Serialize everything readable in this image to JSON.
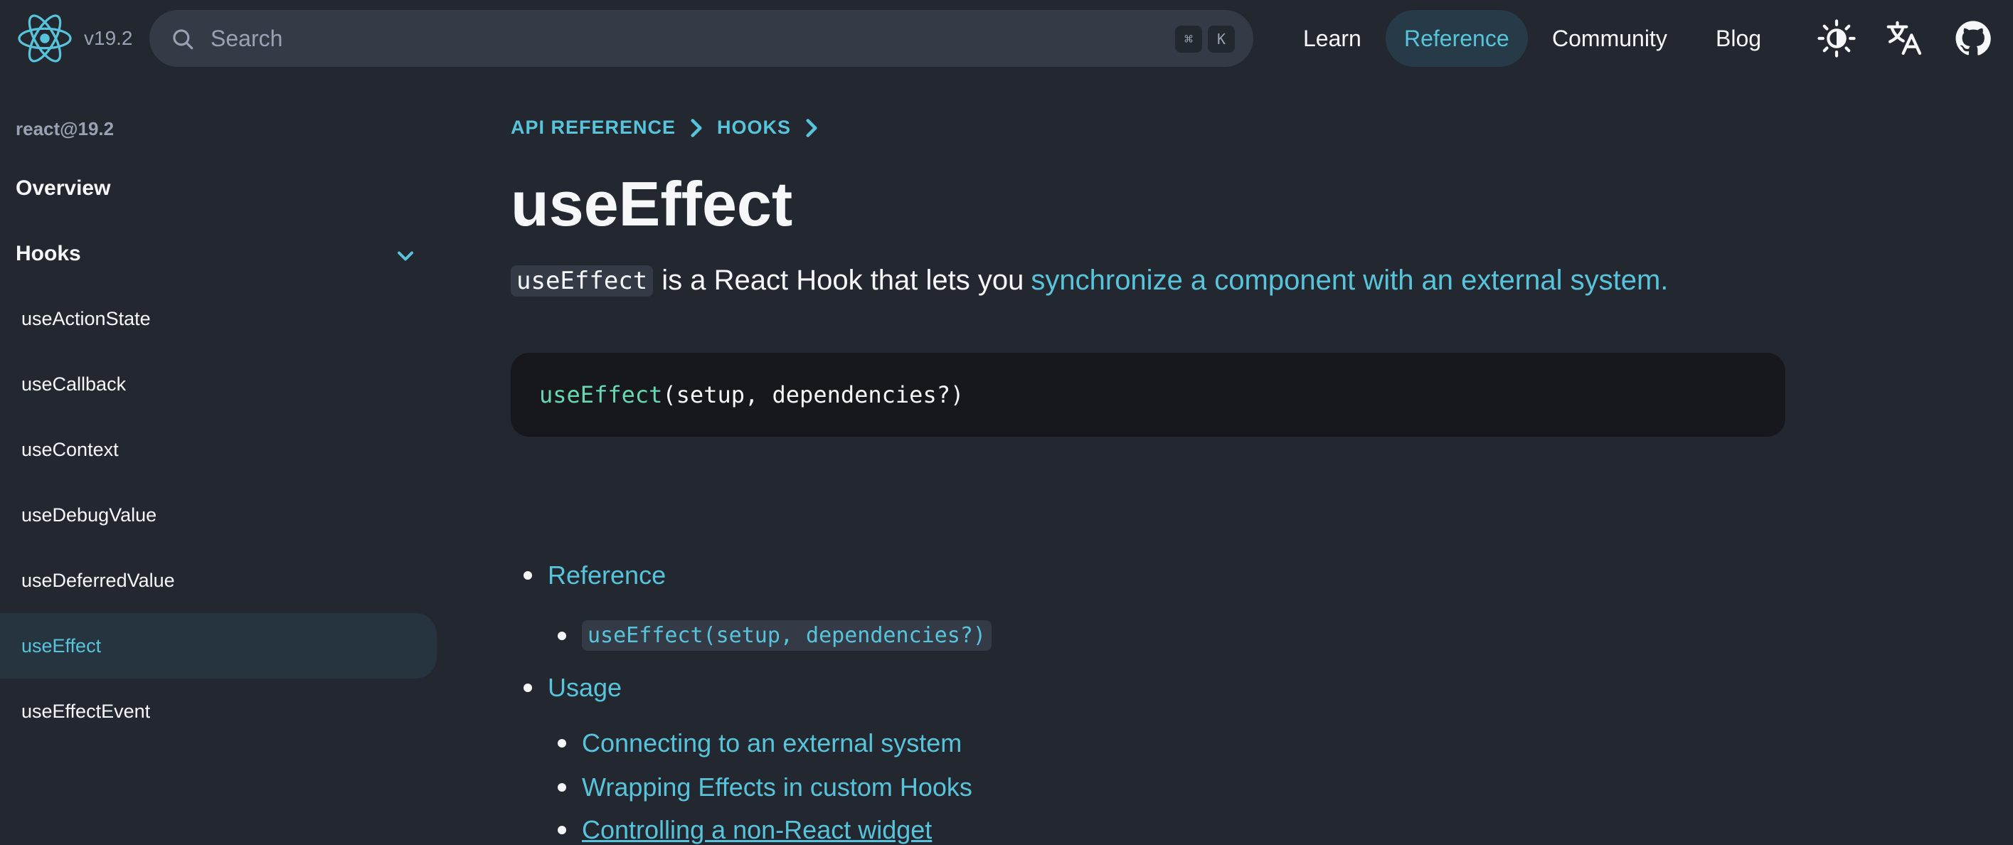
{
  "header": {
    "version": "v19.2",
    "search_placeholder": "Search",
    "shortcut_cmd": "⌘",
    "shortcut_key": "K",
    "nav": {
      "learn": "Learn",
      "reference": "Reference",
      "community": "Community",
      "blog": "Blog"
    }
  },
  "sidebar": {
    "version": "react@19.2",
    "overview": "Overview",
    "section": "Hooks",
    "items": [
      {
        "label": "useActionState"
      },
      {
        "label": "useCallback"
      },
      {
        "label": "useContext"
      },
      {
        "label": "useDebugValue"
      },
      {
        "label": "useDeferredValue"
      },
      {
        "label": "useEffect",
        "active": true
      },
      {
        "label": "useEffectEvent"
      }
    ]
  },
  "main": {
    "breadcrumbs": [
      "API REFERENCE",
      "HOOKS"
    ],
    "title": "useEffect",
    "intro_code": "useEffect",
    "intro_text": "is a React Hook that lets you",
    "intro_link": "synchronize a component with an external system.",
    "signature_fn": "useEffect",
    "signature_args": "(setup, dependencies?)",
    "toc": {
      "reference": "Reference",
      "reference_sub": "useEffect(setup, dependencies?)",
      "usage": "Usage",
      "usage_items": [
        "Connecting to an external system",
        "Wrapping Effects in custom Hooks",
        "Controlling a non-React widget"
      ]
    }
  },
  "colors": {
    "background": "#23272f",
    "accent": "#58c4dc",
    "code_background": "#16181d"
  }
}
